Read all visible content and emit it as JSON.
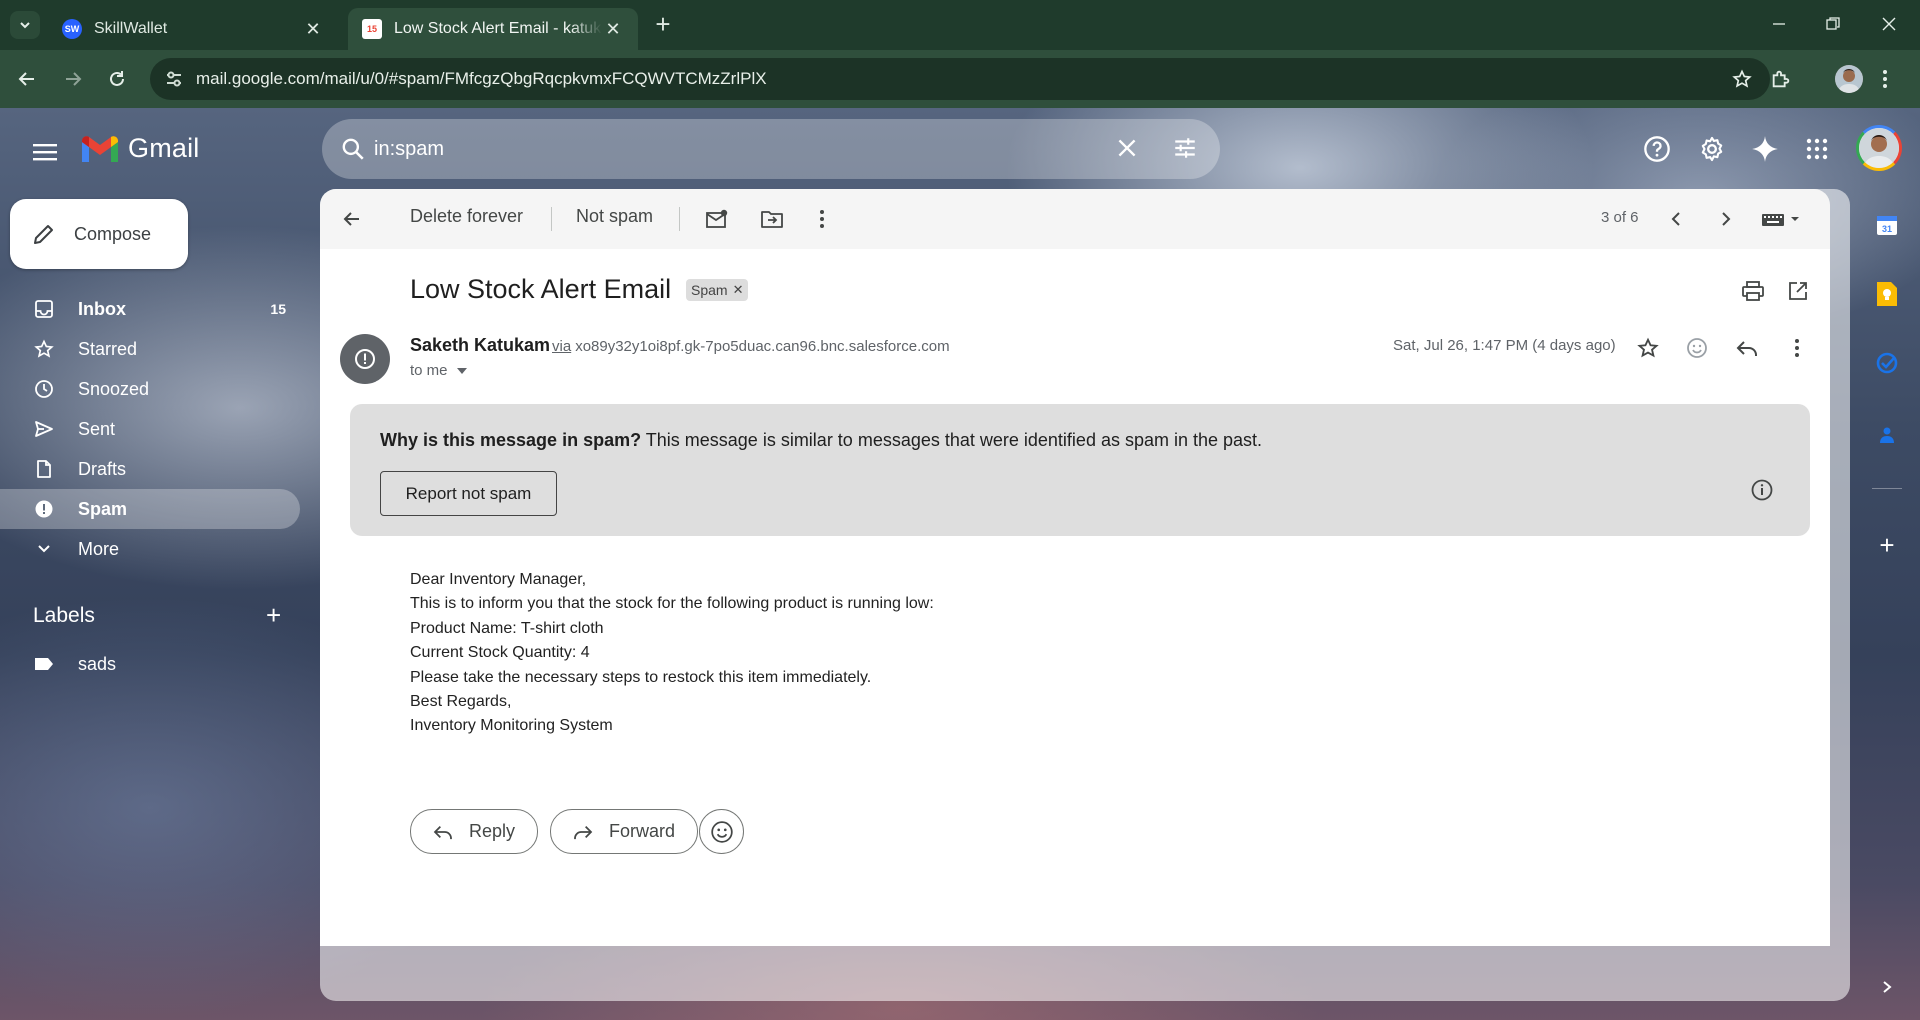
{
  "browser": {
    "tabs": [
      {
        "title": "SkillWallet",
        "favicon": "SW"
      },
      {
        "title": "Low Stock Alert Email - katukam",
        "favicon": "15"
      }
    ],
    "url": "mail.google.com/mail/u/0/#spam/FMfcgzQbgRqcpkvmxFCQWVTCMzZrlPlX"
  },
  "gmail": {
    "brand": "Gmail",
    "search_query": "in:spam",
    "compose_label": "Compose",
    "nav": [
      {
        "label": "Inbox",
        "count": "15"
      },
      {
        "label": "Starred",
        "count": ""
      },
      {
        "label": "Snoozed",
        "count": ""
      },
      {
        "label": "Sent",
        "count": ""
      },
      {
        "label": "Drafts",
        "count": ""
      },
      {
        "label": "Spam",
        "count": ""
      },
      {
        "label": "More",
        "count": ""
      }
    ],
    "labels_title": "Labels",
    "labels": [
      "sads"
    ]
  },
  "toolbar": {
    "delete_forever": "Delete forever",
    "not_spam": "Not spam",
    "pager": "3 of 6"
  },
  "message": {
    "subject": "Low Stock Alert Email",
    "chip": "Spam",
    "sender_name": "Saketh Katukam",
    "via_word": "via",
    "sender_domain": "xo89y32y1oi8pf.gk-7po5duac.can96.bnc.salesforce.com",
    "to": "to me",
    "date": "Sat, Jul 26, 1:47 PM (4 days ago)",
    "spam_why_bold": "Why is this message in spam?",
    "spam_why_text": " This message is similar to messages that were identified as spam in the past.",
    "report_not_spam": "Report not spam",
    "body": [
      "Dear Inventory Manager,",
      "This is to inform you that the stock for the following product is running low:",
      "Product Name: T-shirt cloth",
      "Current Stock Quantity: 4",
      "Please take the necessary steps to restock this item immediately.",
      "Best Regards,",
      "Inventory Monitoring System"
    ],
    "reply_label": "Reply",
    "forward_label": "Forward"
  },
  "colors": {
    "chrome_tabbar": "#1f3b2c",
    "chrome_toolbar": "#2f4f3c",
    "spam_banner": "#dedede"
  }
}
